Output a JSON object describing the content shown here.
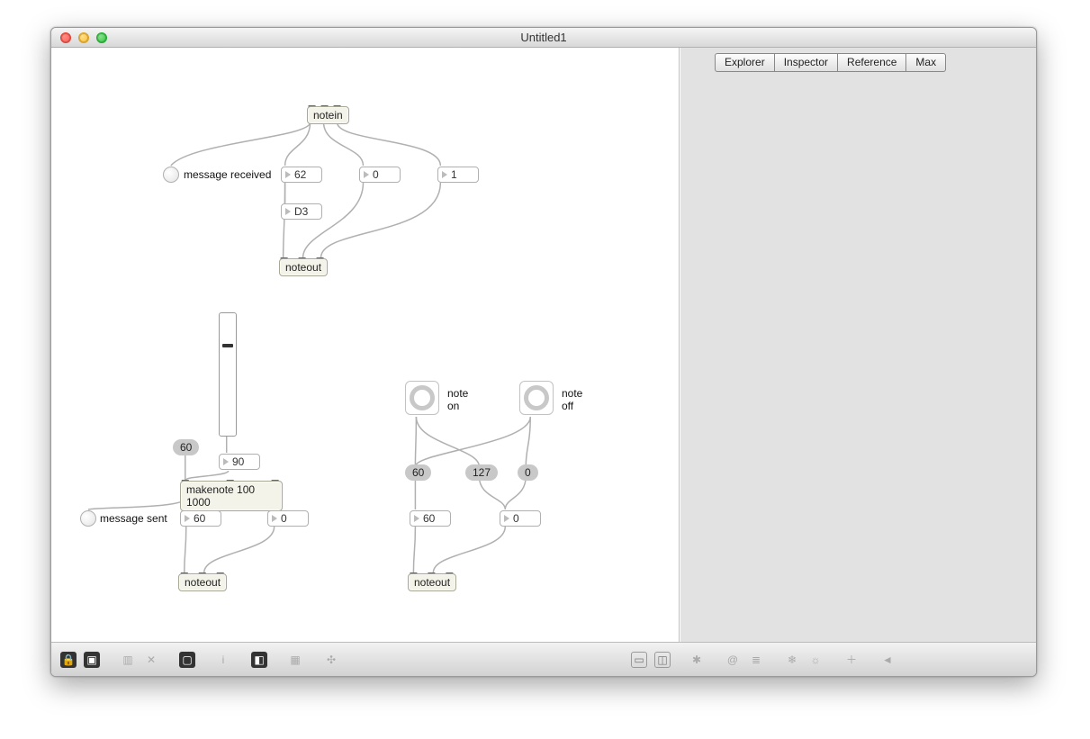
{
  "window": {
    "title": "Untitled1"
  },
  "sidebar": {
    "tabs": [
      "Explorer",
      "Inspector",
      "Reference",
      "Max"
    ]
  },
  "objects": {
    "notein": "notein",
    "noteout": "noteout",
    "makenote": "makenote 100 1000"
  },
  "labels": {
    "msg_received": "message received",
    "msg_sent": "message sent",
    "note_on_a": "note",
    "note_on_b": "on",
    "note_off_a": "note",
    "note_off_b": "off"
  },
  "values": {
    "v62": "62",
    "v0a": "0",
    "v1": "1",
    "d3": "D3",
    "slider_msg": "60",
    "v90": "90",
    "v60a": "60",
    "v0b": "0",
    "pill60": "60",
    "pill127": "127",
    "pill0": "0",
    "v60b": "60",
    "v0c": "0"
  },
  "bottombar_left_icons": [
    "lock-icon",
    "layers-icon",
    "camera-icon",
    "x-icon",
    "screen-icon",
    "info-icon",
    "menu-icon",
    "grid-icon",
    "sparkle-icon"
  ],
  "bottombar_left_right_icons": [
    "view-single-icon",
    "view-split-icon"
  ],
  "bottombar_right_icons": [
    "gear-icon",
    "at-icon",
    "list-icon",
    "snow-icon",
    "sun-icon",
    "plus-icon",
    "back-icon"
  ]
}
